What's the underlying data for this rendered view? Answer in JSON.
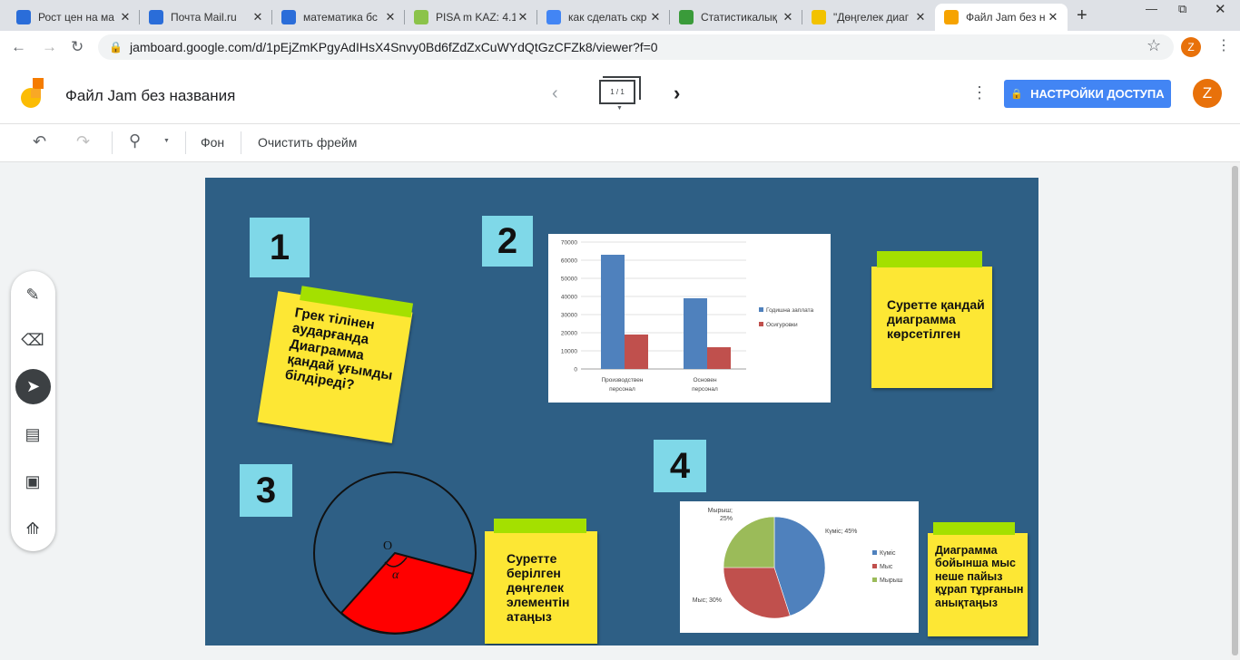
{
  "browser": {
    "tabs": [
      {
        "title": "Рост цен на ма",
        "icon": "mail-ru-icon",
        "color": "#2a6dd9"
      },
      {
        "title": "Почта Mail.ru",
        "icon": "mail-icon",
        "color": "#2a6dd9"
      },
      {
        "title": "математика бс",
        "icon": "mail-icon",
        "color": "#2a6dd9"
      },
      {
        "title": "PISA m KAZ: 4.1",
        "icon": "pisa-icon",
        "color": "#8bc34a"
      },
      {
        "title": "как сделать скр",
        "icon": "google-icon",
        "color": "#4285f4"
      },
      {
        "title": "Статистикалық",
        "icon": "globe-icon",
        "color": "#3a9b3a"
      },
      {
        "title": "\"Дөңгелек диаг",
        "icon": "pencil-icon",
        "color": "#f2c200"
      },
      {
        "title": "Файл Jam без н",
        "icon": "jamboard-icon",
        "color": "#f6a300",
        "active": true
      }
    ],
    "url": "jamboard.google.com/d/1pEjZmKPgyAdIHsX4Snvy0Bd6fZdZxCuWYdQtGzCFZk8/viewer?f=0",
    "profile_letter": "Z"
  },
  "app": {
    "title": "Файл Jam без названия",
    "frame_counter": "1 / 1",
    "share_label": "НАСТРОЙКИ ДОСТУПА",
    "avatar_letter": "Z",
    "accent": "#4285f4",
    "avatar_color": "#e8710a"
  },
  "toolbar": {
    "background_label": "Фон",
    "clear_label": "Очистить фрейм"
  },
  "side_tools": [
    "pen-icon",
    "eraser-icon",
    "select-icon",
    "sticky-note-icon",
    "image-icon",
    "laser-icon"
  ],
  "board": {
    "background": "#2e5f85",
    "numbers": [
      "1",
      "2",
      "3",
      "4"
    ],
    "sticky1": "Грек тілінен аударғанда Диаграмма қандай ұғымды білдіреді?",
    "sticky2": "Суретте қандай диаграмма көрсетілген",
    "sticky3": "Суретте берілген дөңгелек элементін атаңыз",
    "sticky4": "Диаграмма бойынша мыс неше пайыз құрап тұрғанын анықтаңыз",
    "circle_center_label": "O",
    "circle_angle_label": "α"
  },
  "chart_data": [
    {
      "type": "bar",
      "categories": [
        "Производствен персонал",
        "Основен персонал"
      ],
      "series": [
        {
          "name": "Годишна заплата",
          "values": [
            63000,
            39000
          ],
          "color": "#4f81bd"
        },
        {
          "name": "Осигуровки",
          "values": [
            19000,
            12000
          ],
          "color": "#c0504d"
        }
      ],
      "ylim": [
        0,
        70000
      ],
      "yticks": [
        "70000",
        "60000",
        "50000",
        "40000",
        "30000",
        "20000",
        "10000",
        "0"
      ],
      "legend": "right"
    },
    {
      "type": "pie",
      "slices": [
        {
          "name": "Күміс",
          "value": 45,
          "label": "Күміс; 45%",
          "color": "#4f81bd"
        },
        {
          "name": "Мыс",
          "value": 30,
          "label": "Мыс; 30%",
          "color": "#c0504d"
        },
        {
          "name": "Мырыш",
          "value": 25,
          "label": "Мырыш;\n25%",
          "color": "#9bbb59"
        }
      ],
      "legend": "right"
    }
  ]
}
